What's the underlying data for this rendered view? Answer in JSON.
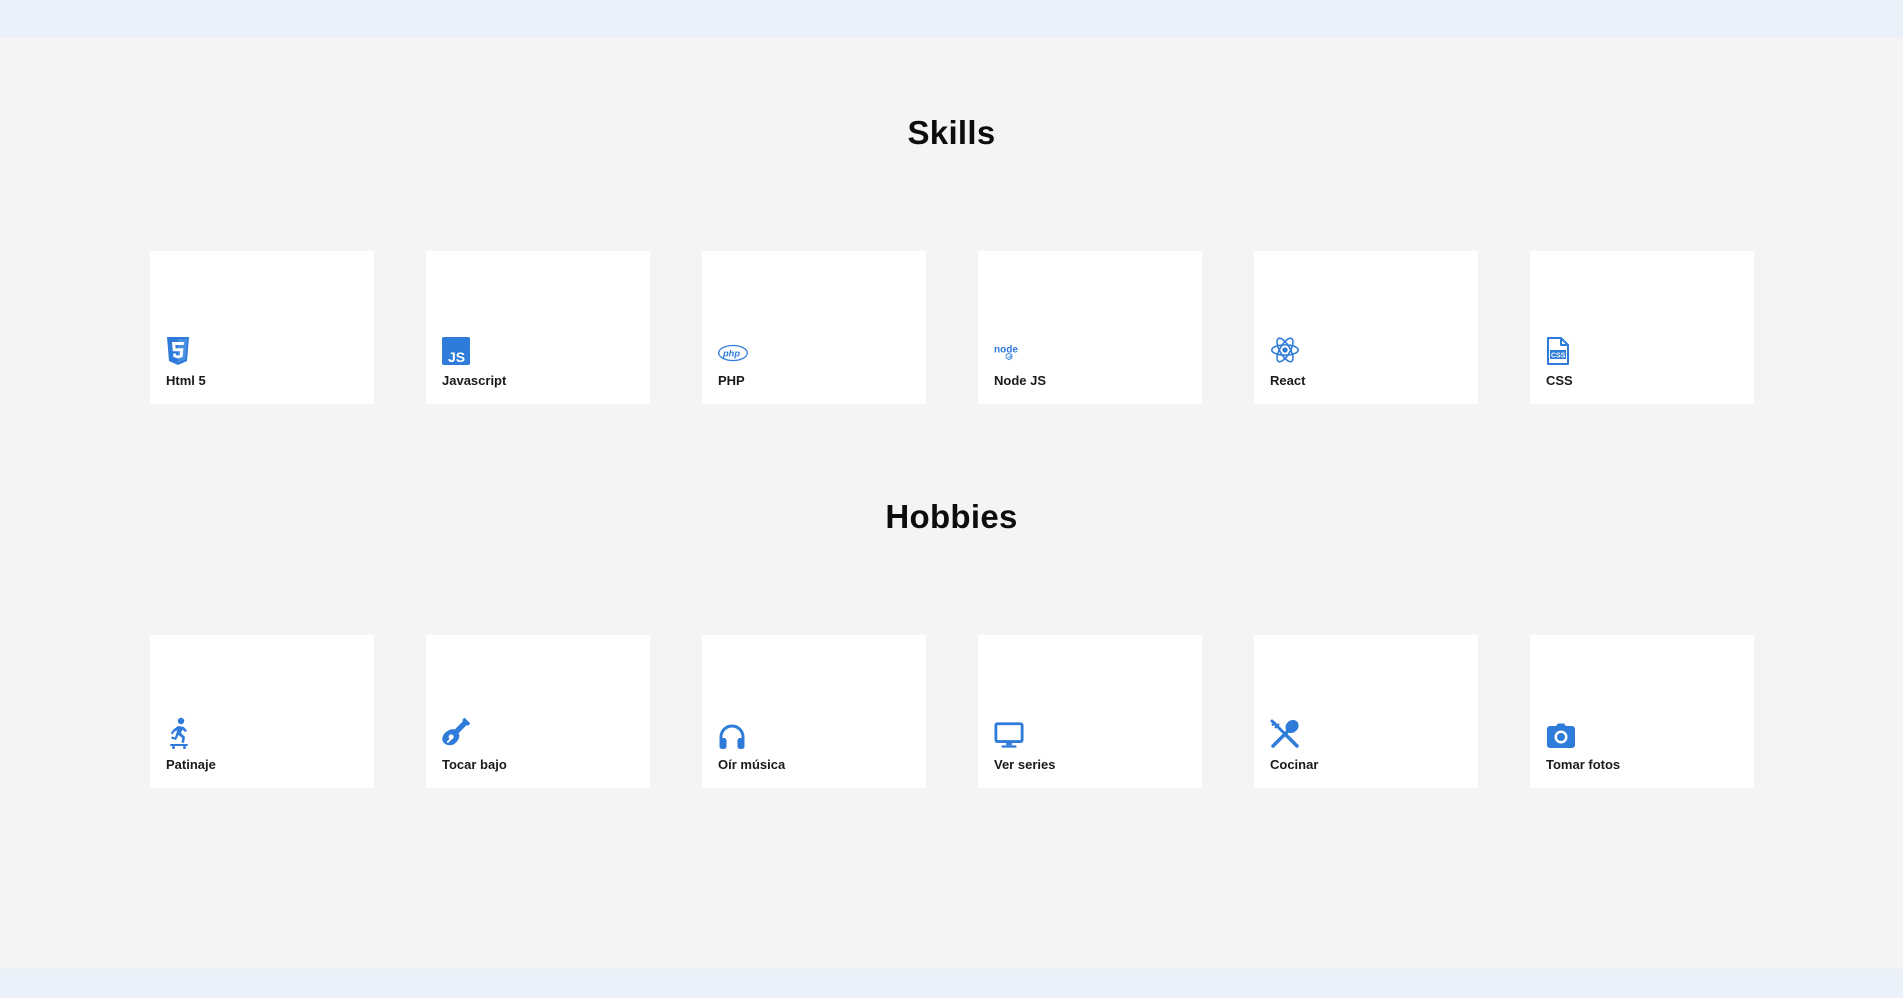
{
  "colors": {
    "accent": "#2f7bd9",
    "page_background": "#f4f4f4",
    "band_background": "#ebf1fb",
    "card_background": "#ffffff"
  },
  "skills": {
    "title": "Skills",
    "items": [
      {
        "label": "Html 5",
        "icon": "html5-icon"
      },
      {
        "label": "Javascript",
        "icon": "javascript-icon"
      },
      {
        "label": "PHP",
        "icon": "php-icon"
      },
      {
        "label": "Node JS",
        "icon": "nodejs-icon"
      },
      {
        "label": "React",
        "icon": "react-icon"
      },
      {
        "label": "CSS",
        "icon": "css-file-icon"
      }
    ]
  },
  "hobbies": {
    "title": "Hobbies",
    "items": [
      {
        "label": "Patinaje",
        "icon": "skateboarding-icon"
      },
      {
        "label": "Tocar bajo",
        "icon": "guitar-icon"
      },
      {
        "label": "Oír música",
        "icon": "headphones-icon"
      },
      {
        "label": "Ver series",
        "icon": "tv-icon"
      },
      {
        "label": "Cocinar",
        "icon": "utensils-icon"
      },
      {
        "label": "Tomar fotos",
        "icon": "camera-icon"
      }
    ]
  }
}
